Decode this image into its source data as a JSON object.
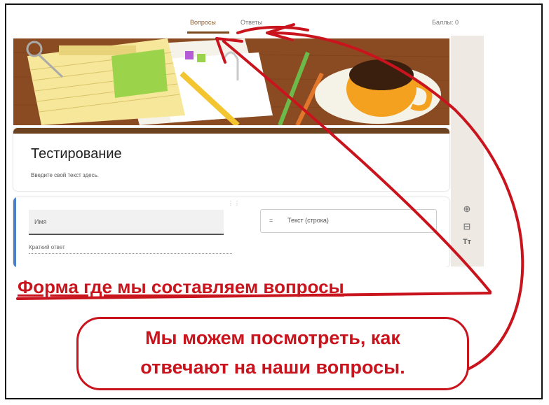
{
  "tabs": {
    "questions": "Вопросы",
    "answers": "Ответы",
    "total": "Баллы: 0"
  },
  "form": {
    "title": "Тестирование",
    "description": "Введите свой текст здесь."
  },
  "question": {
    "name_placeholder": "Имя",
    "type_icon": "=",
    "type_label": "Текст (строка)",
    "answer_hint": "Краткий ответ",
    "drag": "⋮⋮"
  },
  "tools": [
    "⊕",
    "⊟",
    "Tт"
  ],
  "caption": "Форма где мы составляем вопросы",
  "callout": {
    "line1": "Мы можем посмотреть, как",
    "line2": "отвечают на наши вопросы."
  },
  "colors": {
    "accent": "#c9141d",
    "header_brown": "#6b4320",
    "question_blue": "#4a7fc9"
  }
}
